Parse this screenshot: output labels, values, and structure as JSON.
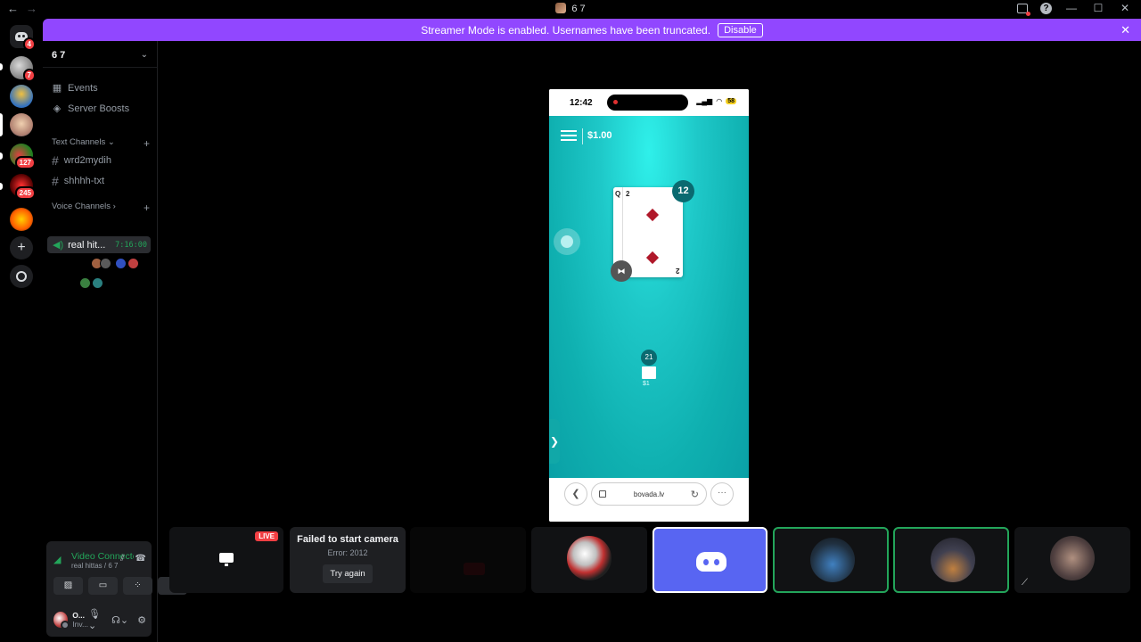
{
  "window": {
    "title": "6 7",
    "nav_back": "←",
    "nav_forward": "→",
    "controls": [
      "—",
      "☐",
      "✕"
    ]
  },
  "guilds": {
    "home_badge": "4",
    "items": [
      {
        "name": "server-1",
        "badge": "7"
      },
      {
        "name": "server-2",
        "badge": ""
      },
      {
        "name": "server-3",
        "badge": ""
      },
      {
        "name": "server-4",
        "badge": "127"
      },
      {
        "name": "server-5",
        "badge": "245"
      },
      {
        "name": "server-6",
        "badge": ""
      }
    ],
    "add_label": "+"
  },
  "banner": {
    "message": "Streamer Mode is enabled. Usernames have been truncated.",
    "disable_label": "Disable",
    "close_label": "✕"
  },
  "server": {
    "name": "6 7",
    "chevron": "⌄",
    "events_label": "Events",
    "boosts_label": "Server Boosts",
    "text_category": "Text Channels",
    "text_channels": [
      "wrd2mydih",
      "shhhh-txt"
    ],
    "voice_category": "Voice Channels",
    "voice_channel": {
      "name": "real hit...",
      "timer": "7:16:00"
    },
    "add_symbol": "+"
  },
  "user_panel": {
    "voice_status": "Video Connected",
    "voice_location": "real hittas / 6 7",
    "controls": [
      "camera-off",
      "screen-share",
      "activities",
      "soundboard"
    ],
    "username": "O...",
    "user_status": "Inv..."
  },
  "stream": {
    "status_time": "12:42",
    "battery": "58",
    "balance": "$1.00",
    "dealer_card": {
      "rank": "2",
      "hidden_rank": "Q"
    },
    "dealer_score": "12",
    "player_score": "21",
    "player_bet": "$1",
    "url": "bovada.lv",
    "side_tab": "❯"
  },
  "tiles": {
    "live_label": "LIVE",
    "camera_error_title": "Failed to start camera",
    "camera_error_code": "Error: 2012",
    "retry_label": "Try again"
  },
  "colors": {
    "banner": "#9147ff",
    "connected_green": "#23a55a",
    "blurple": "#5865f2",
    "table": "#1ec8c8",
    "badge_red": "#f23f43"
  }
}
